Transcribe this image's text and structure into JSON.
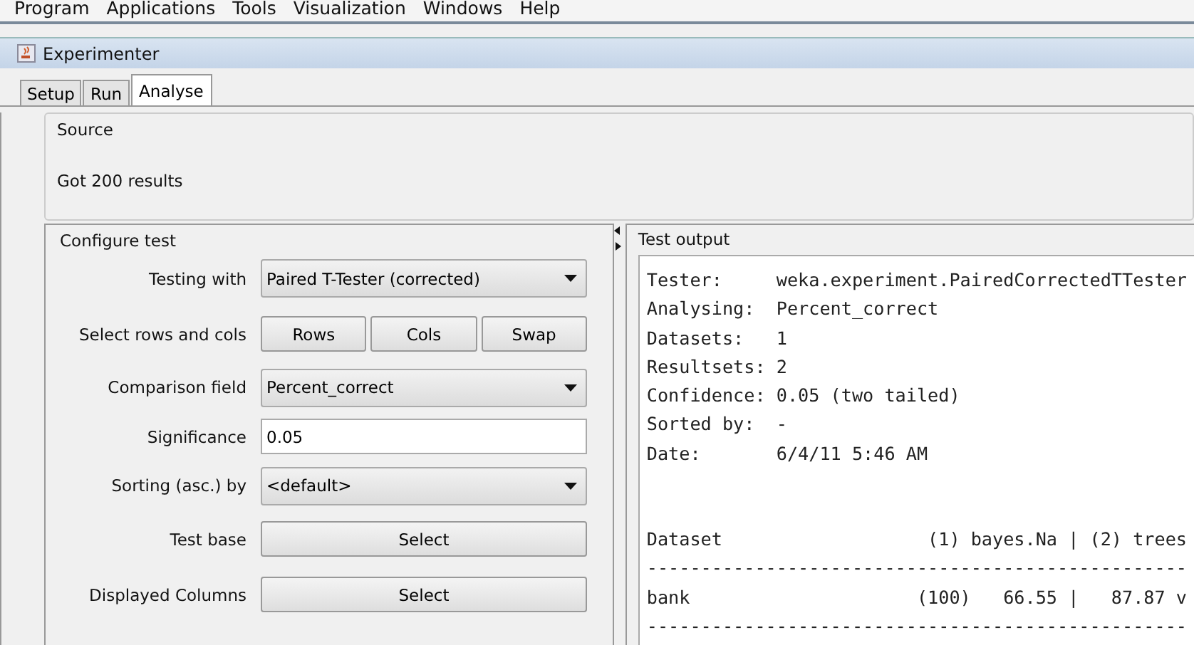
{
  "menu_bar": [
    "Program",
    "Applications",
    "Tools",
    "Visualization",
    "Windows",
    "Help"
  ],
  "window": {
    "title": "Experimenter"
  },
  "tabs": [
    {
      "label": "Setup",
      "selected": false
    },
    {
      "label": "Run",
      "selected": false
    },
    {
      "label": "Analyse",
      "selected": true
    }
  ],
  "source": {
    "title": "Source",
    "status": "Got 200 results"
  },
  "configure_test": {
    "title": "Configure test",
    "rows": [
      {
        "label": "Testing with",
        "kind": "dropdown",
        "value": "Paired T-Tester (corrected)"
      },
      {
        "label": "Select rows and cols",
        "kind": "buttons",
        "buttons": [
          "Rows",
          "Cols",
          "Swap"
        ]
      },
      {
        "label": "Comparison field",
        "kind": "dropdown",
        "value": "Percent_correct"
      },
      {
        "label": "Significance",
        "kind": "input",
        "value": "0.05"
      },
      {
        "label": "Sorting (asc.) by",
        "kind": "dropdown",
        "value": "<default>"
      },
      {
        "label": "Test base",
        "kind": "buttons",
        "buttons": [
          "Select"
        ]
      },
      {
        "label": "Displayed Columns",
        "kind": "buttons",
        "buttons": [
          "Select"
        ]
      }
    ]
  },
  "test_output": {
    "title": "Test output",
    "header_lines": [
      "Tester:     weka.experiment.PairedCorrectedTTester",
      "Analysing:  Percent_correct",
      "Datasets:   1",
      "Resultsets: 2",
      "Confidence: 0.05 (two tailed)",
      "Sorted by:  -",
      "Date:       6/4/11 5:46 AM"
    ],
    "table_lines": [
      "Dataset                   (1) bayes.Na | (2) trees",
      "--------------------------------------------------",
      "bank                     (100)   66.55 |   87.87 v",
      "--------------------------------------------------"
    ]
  }
}
